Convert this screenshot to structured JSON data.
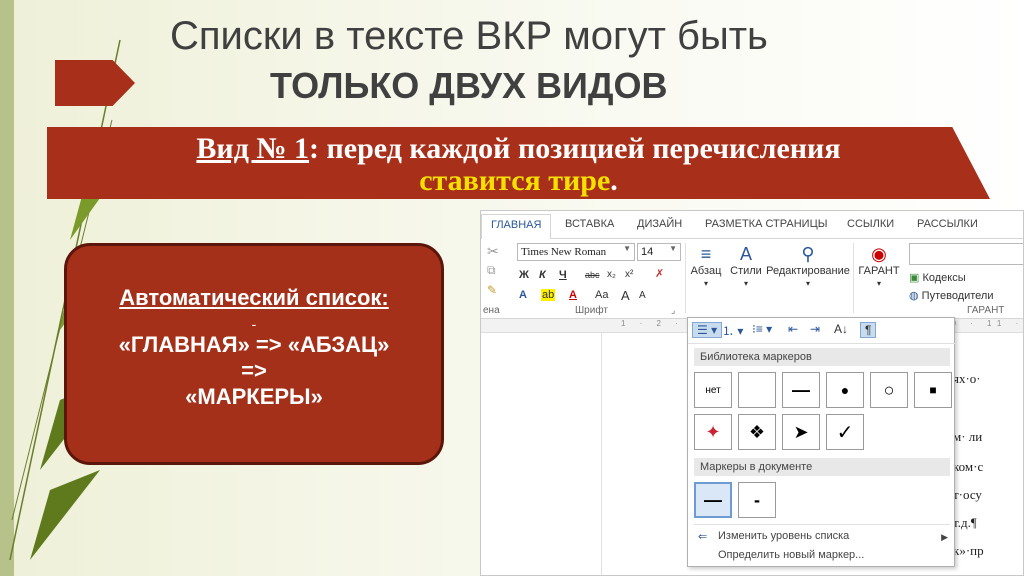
{
  "slide": {
    "title_line1": "Списки в тексте ВКР могут быть",
    "title_line2": "ТОЛЬКО ДВУХ ВИДОВ",
    "banner": {
      "part_underlined": "Вид № 1",
      "part_rest": ": перед каждой позицией перечисления",
      "line2_yellow": "ставится тире",
      "line2_end": "."
    },
    "box": {
      "title": "Автоматический список:",
      "dash": "-",
      "line1": "«ГЛАВНАЯ» => «АБЗАЦ»",
      "line2": "=>",
      "line3": "«МАРКЕРЫ»"
    }
  },
  "word": {
    "tabs": [
      "ГЛАВНАЯ",
      "ВСТАВКА",
      "ДИЗАЙН",
      "РАЗМЕТКА СТРАНИЦЫ",
      "ССЫЛКИ",
      "РАССЫЛКИ"
    ],
    "font_name": "Times New Roman",
    "font_size": "14",
    "buttons": {
      "paragraph": "Абзац",
      "styles": "Стили",
      "editing": "Редактирование",
      "garant": "ГАРАНТ",
      "codecs": "Кодексы",
      "guides": "Путеводители"
    },
    "groups": {
      "left": "ена",
      "font": "Шрифт",
      "garant": "ГАРАНТ"
    },
    "format_glyphs": {
      "bold": "Ж",
      "italic": "К",
      "underline": "Ч",
      "strike": "abc",
      "sub": "x₂",
      "sup": "x²",
      "text_effects": "A",
      "highlight": "ab",
      "font_color": "A",
      "case": "Aa",
      "grow": "A",
      "shrink": "A"
    },
    "ruler": "1 · 2 · 3 · 4 · 5 · 6 · 7 · 8 · 9 · 10 · 11 · 12 · 13",
    "doc_fragments": [
      "ях·о·",
      "м· ли",
      "ком·с",
      "т·осу",
      "т.д.¶",
      "к»·пр"
    ],
    "bullet_menu": {
      "library_header": "Библиотека маркеров",
      "none_label": "нет",
      "library_row1": [
        "нет",
        "",
        "—",
        "●",
        "○",
        "■"
      ],
      "library_row2": [
        "✦",
        "❖",
        "➤",
        "✓"
      ],
      "document_header": "Маркеры в документе",
      "document_bullets": [
        "—",
        "-"
      ],
      "change_level": "Изменить уровень списка",
      "define_new": "Определить новый маркер..."
    }
  }
}
